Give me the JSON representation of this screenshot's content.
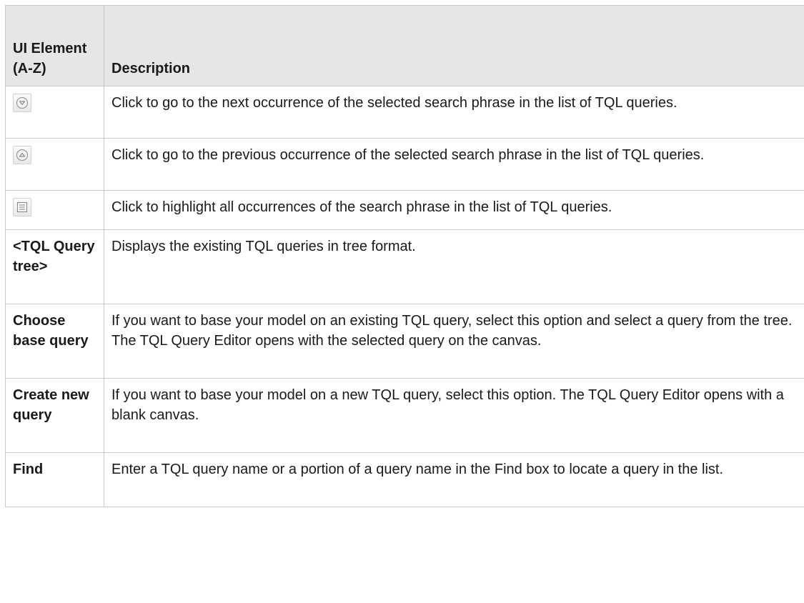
{
  "table": {
    "header": {
      "col1": "UI Element (A-Z)",
      "col2": "Description"
    },
    "rows": [
      {
        "element": "",
        "icon": "next-occurrence-icon",
        "description": "Click to go to the next occurrence of the selected search phrase in the list of TQL queries."
      },
      {
        "element": "",
        "icon": "previous-occurrence-icon",
        "description": "Click to go to the previous occurrence of the selected search phrase in the list of TQL queries."
      },
      {
        "element": "",
        "icon": "highlight-all-icon",
        "description": "Click to highlight all occurrences of the search phrase in the list of TQL queries."
      },
      {
        "element": "<TQL Query tree>",
        "description": "Displays the existing TQL queries in tree format."
      },
      {
        "element": "Choose base query",
        "description": "If you want to base your model on an existing TQL query, select this option and select a query from the tree. The TQL Query Editor opens with the selected query on the canvas."
      },
      {
        "element": "Create new query",
        "description": "If you want to base your model on a new TQL query, select this option. The TQL Query Editor opens with a blank canvas."
      },
      {
        "element": "Find",
        "description": "Enter a TQL query name or a portion of a query name in the Find box to locate a query in the list."
      }
    ]
  }
}
